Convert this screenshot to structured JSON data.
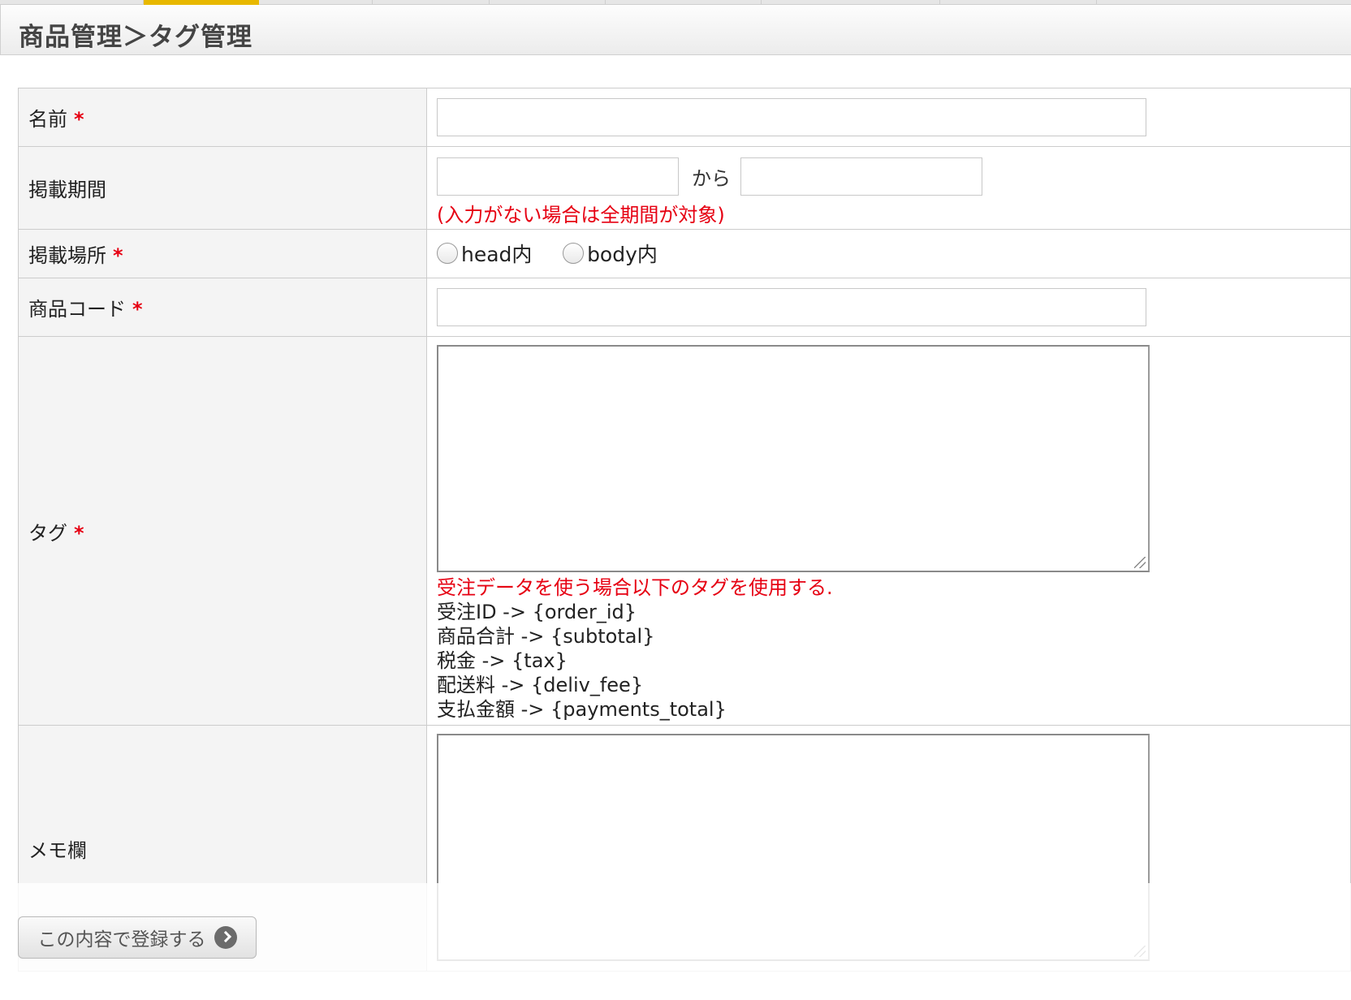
{
  "header": {
    "title": "商品管理＞タグ管理"
  },
  "form": {
    "required_mark": "*",
    "name": {
      "label": "名前",
      "value": "",
      "placeholder": ""
    },
    "period": {
      "label": "掲載期間",
      "from_value": "",
      "to_value": "",
      "separator": "から",
      "note": "(入力がない場合は全期間が対象)"
    },
    "placement": {
      "label": "掲載場所",
      "options": [
        "head内",
        "body内"
      ]
    },
    "product_code": {
      "label": "商品コード",
      "value": ""
    },
    "tag": {
      "label": "タグ",
      "value": "",
      "help_title": "受注データを使う場合以下のタグを使用する.",
      "help_lines": [
        "受注ID -> {order_id}",
        "商品合計 -> {subtotal}",
        "税金 -> {tax}",
        "配送料 -> {deliv_fee}",
        "支払金額 -> {payments_total}"
      ]
    },
    "memo": {
      "label": "メモ欄",
      "value": ""
    }
  },
  "actions": {
    "submit_label": "この内容で登録する",
    "submit_icon": "arrow-right-icon"
  },
  "colors": {
    "required": "#e60012",
    "active_tab": "#e8b800",
    "label_bg": "#f4f4f4"
  }
}
